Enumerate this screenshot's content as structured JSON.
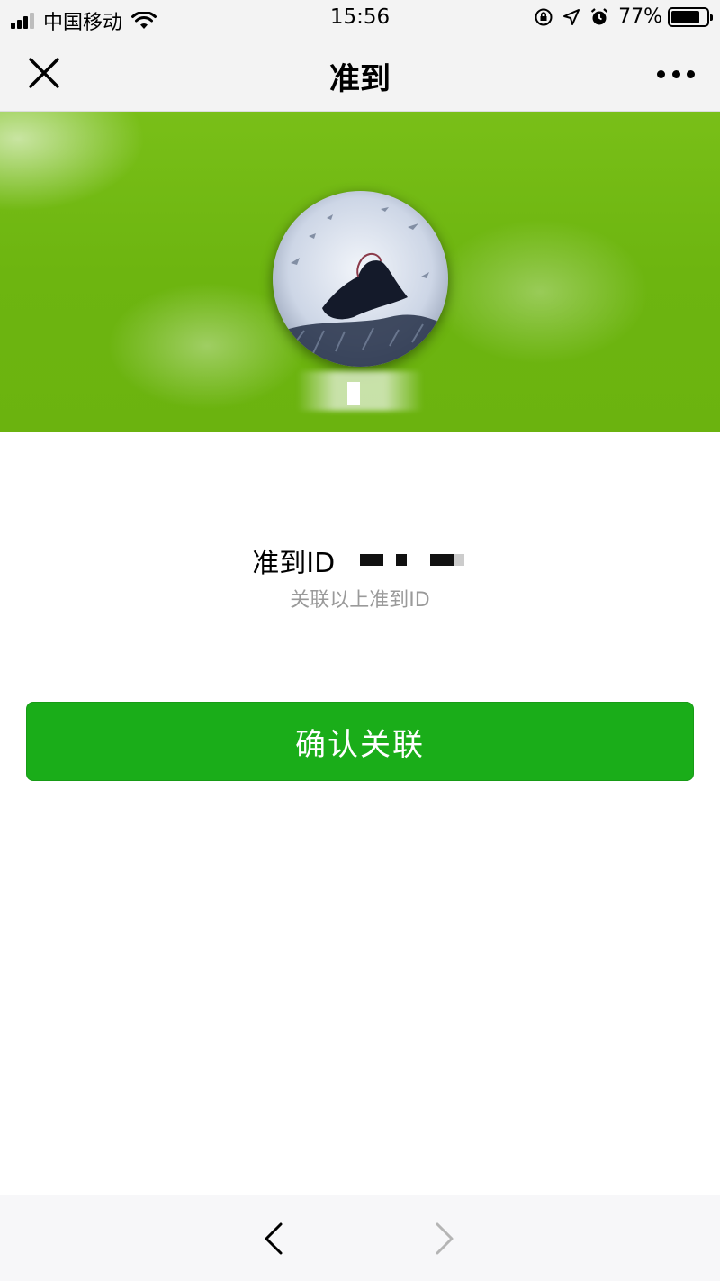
{
  "status_bar": {
    "carrier": "中国移动",
    "time": "15:56",
    "battery_percent": "77%",
    "battery_level": 0.77,
    "icons": [
      "signal-icon",
      "wifi-icon",
      "rotation-lock-icon",
      "location-icon",
      "alarm-icon",
      "battery-icon"
    ]
  },
  "nav": {
    "title": "准到",
    "close_icon": "close-icon",
    "more_icon": "more-icon"
  },
  "profile": {
    "id_label": "准到ID",
    "caption": "关联以上准到ID"
  },
  "actions": {
    "confirm_label": "确认关联",
    "confirm_color": "#1aad19"
  },
  "toolbar": {
    "back_icon": "back-arrow-icon",
    "forward_icon": "forward-arrow-icon"
  },
  "colors": {
    "banner_green": "#6db510",
    "bar_background": "#f3f3f3"
  }
}
